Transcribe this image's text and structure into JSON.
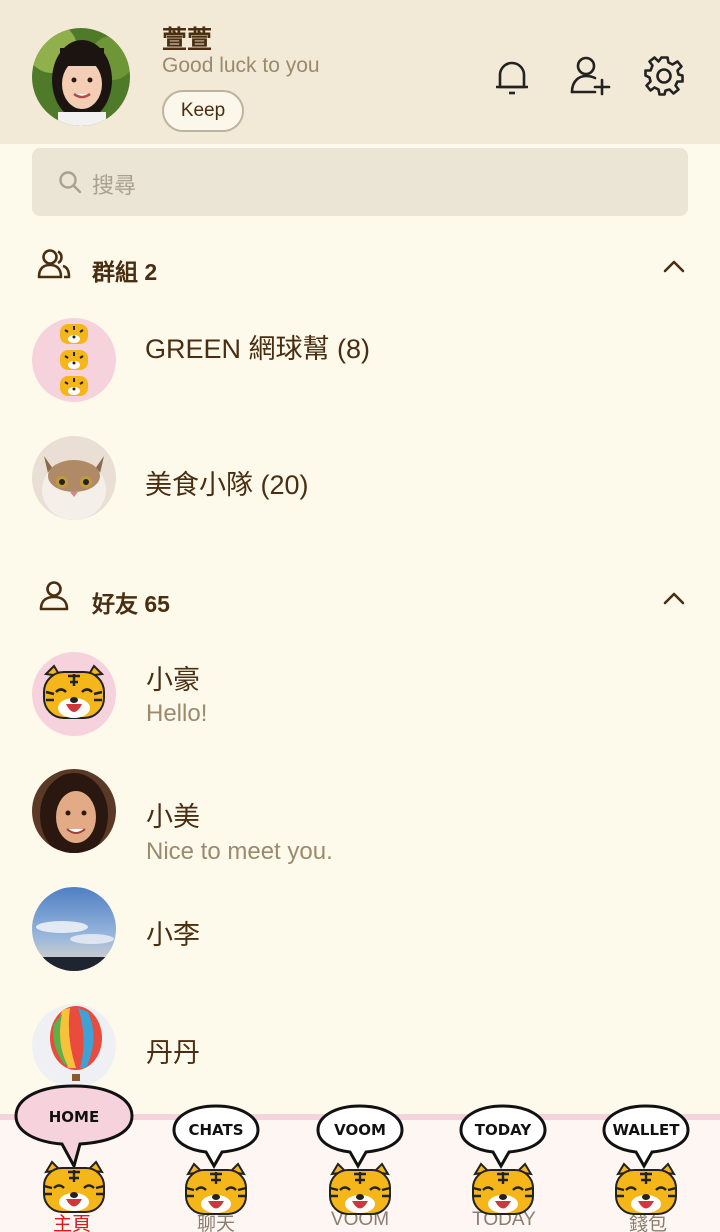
{
  "profile": {
    "name": "萱萱",
    "status": "Good luck to you",
    "keep_label": "Keep"
  },
  "search": {
    "placeholder": "搜尋"
  },
  "groups": {
    "title": "群組 2",
    "items": [
      {
        "name": "GREEN 網球幫 (8)"
      },
      {
        "name": "美食小隊 (20)"
      }
    ]
  },
  "friends": {
    "title": "好友 65",
    "items": [
      {
        "name": "小豪",
        "status": "Hello!"
      },
      {
        "name": "小美",
        "status": "Nice to meet you."
      },
      {
        "name": "小李",
        "status": ""
      },
      {
        "name": "丹丹",
        "status": ""
      }
    ]
  },
  "nav": {
    "items": [
      {
        "bubble": "HOME",
        "label": "主頁",
        "active": true
      },
      {
        "bubble": "CHATS",
        "label": "聊天",
        "active": false
      },
      {
        "bubble": "VOOM",
        "label": "VOOM",
        "active": false
      },
      {
        "bubble": "TODAY",
        "label": "TODAY",
        "active": false
      },
      {
        "bubble": "WALLET",
        "label": "錢包",
        "active": false
      }
    ]
  },
  "colors": {
    "background": "#fefaeb",
    "header": "#f2ead6",
    "text": "#4a2e12",
    "subtext": "#9a8a6e",
    "active_nav": "#d81b1b",
    "nav_border": "#f6d3dc"
  }
}
